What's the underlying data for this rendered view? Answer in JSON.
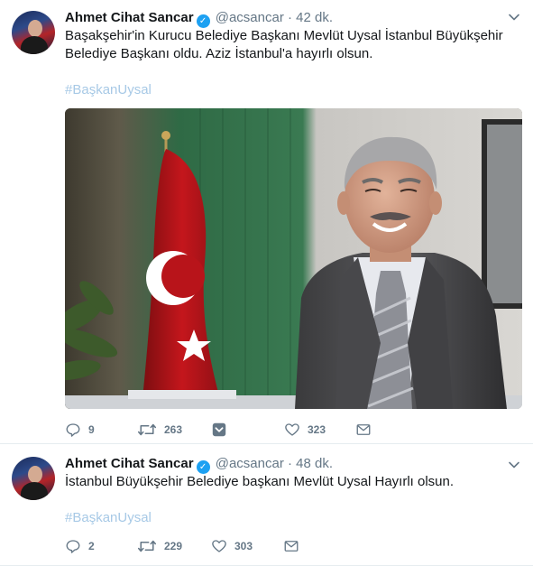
{
  "tweets": [
    {
      "author_name": "Ahmet Cihat Sancar",
      "handle": "@acsancar",
      "separator": "·",
      "time": "42 dk.",
      "text_line1": "Başakşehir'in Kurucu Belediye Başkanı Mevlüt Uysal İstanbul Büyükşehir",
      "text_line2": "Belediye Başkanı oldu. Aziz İstanbul'a hayırlı olsun.",
      "hashtag": "#BaşkanUysal",
      "replies": "9",
      "retweets": "263",
      "likes": "323"
    },
    {
      "author_name": "Ahmet Cihat Sancar",
      "handle": "@acsancar",
      "separator": "·",
      "time": "48 dk.",
      "text_line1": "İstanbul Büyükşehir Belediye başkanı Mevlüt Uysal Hayırlı olsun.",
      "hashtag": "#BaşkanUysal",
      "replies": "2",
      "retweets": "229",
      "likes": "303"
    }
  ],
  "icons": {
    "reply": "reply-icon",
    "retweet": "retweet-icon",
    "like": "heart-icon",
    "dm": "envelope-icon",
    "caret": "chevron-down-icon",
    "verified": "verified-badge-icon",
    "moments": "moments-icon"
  },
  "colors": {
    "text": "#14171a",
    "muted": "#657786",
    "hashtag": "#a7c9e6",
    "verified": "#1da1f2",
    "divider": "#e6ecf0"
  }
}
